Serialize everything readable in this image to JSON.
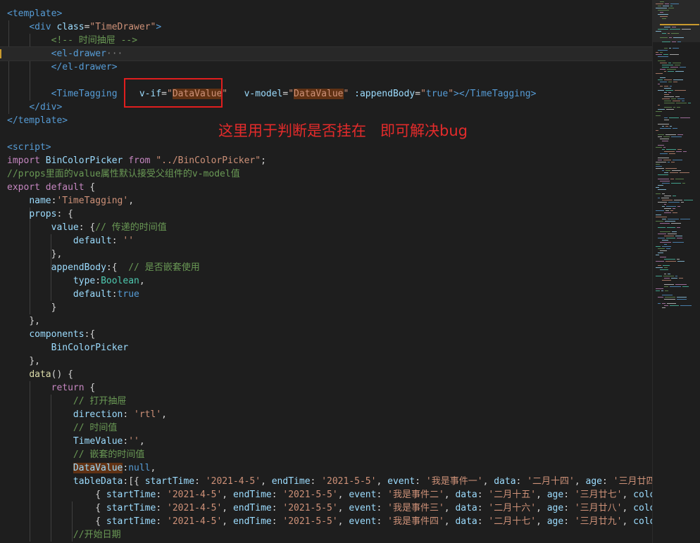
{
  "editor": {
    "lines": [
      [
        [
          "tag",
          "<template>"
        ]
      ],
      [
        [
          "ws",
          "    "
        ],
        [
          "tag",
          "<div "
        ],
        [
          "attr",
          "class"
        ],
        [
          "white",
          "="
        ],
        [
          "str",
          "\"TimeDrawer\""
        ],
        [
          "tag",
          ">"
        ]
      ],
      [
        [
          "ws",
          "        "
        ],
        [
          "cmt",
          "<!-- 时间抽屉 -->"
        ]
      ],
      [
        [
          "ws",
          "        "
        ],
        [
          "tag",
          "<el-drawer"
        ],
        [
          "punc",
          "···"
        ]
      ],
      [
        [
          "ws",
          "        "
        ],
        [
          "tag",
          "</el-drawer>"
        ]
      ],
      [],
      [
        [
          "ws",
          "        "
        ],
        [
          "tag",
          "<TimeTagging  "
        ],
        [
          "ws",
          "  "
        ],
        [
          "attr",
          "v-if"
        ],
        [
          "white",
          "="
        ],
        [
          "str",
          "\""
        ],
        [
          "strhl",
          "DataValue"
        ],
        [
          "str",
          "\""
        ],
        [
          "ws",
          "   "
        ],
        [
          "attr",
          "v-model"
        ],
        [
          "white",
          "="
        ],
        [
          "str",
          "\""
        ],
        [
          "strhl",
          "DataValue"
        ],
        [
          "str",
          "\""
        ],
        [
          "ws",
          " "
        ],
        [
          "attr",
          ":appendBody"
        ],
        [
          "white",
          "="
        ],
        [
          "str",
          "\""
        ],
        [
          "blue",
          "true"
        ],
        [
          "str",
          "\""
        ],
        [
          "tag",
          "></TimeTagging>"
        ]
      ],
      [
        [
          "ws",
          "    "
        ],
        [
          "tag",
          "</div>"
        ]
      ],
      [
        [
          "tag",
          "</template>"
        ]
      ],
      [],
      [
        [
          "tag",
          "<script>"
        ]
      ],
      [
        [
          "kw",
          "import "
        ],
        [
          "ident",
          "BinColorPicker "
        ],
        [
          "kw",
          "from "
        ],
        [
          "str",
          "\"../BinColorPicker\""
        ],
        [
          "white",
          ";"
        ]
      ],
      [
        [
          "cmt",
          "//props里面的value属性默认接受父组件的v-model值"
        ]
      ],
      [
        [
          "kw",
          "export default "
        ],
        [
          "white",
          "{"
        ]
      ],
      [
        [
          "ws",
          "    "
        ],
        [
          "ident",
          "name"
        ],
        [
          "white",
          ":"
        ],
        [
          "str",
          "'TimeTagging'"
        ],
        [
          "white",
          ","
        ]
      ],
      [
        [
          "ws",
          "    "
        ],
        [
          "ident",
          "props"
        ],
        [
          "white",
          ": {"
        ]
      ],
      [
        [
          "ws",
          "        "
        ],
        [
          "ident",
          "value"
        ],
        [
          "white",
          ": {"
        ],
        [
          "cmt",
          "// 传递的时间值"
        ]
      ],
      [
        [
          "ws",
          "            "
        ],
        [
          "ident",
          "default"
        ],
        [
          "white",
          ": "
        ],
        [
          "str",
          "''"
        ]
      ],
      [
        [
          "ws",
          "        "
        ],
        [
          "white",
          "},"
        ]
      ],
      [
        [
          "ws",
          "        "
        ],
        [
          "ident",
          "appendBody"
        ],
        [
          "white",
          ":{  "
        ],
        [
          "cmt",
          "// 是否嵌套使用"
        ]
      ],
      [
        [
          "ws",
          "            "
        ],
        [
          "ident",
          "type"
        ],
        [
          "white",
          ":"
        ],
        [
          "type",
          "Boolean"
        ],
        [
          "white",
          ","
        ]
      ],
      [
        [
          "ws",
          "            "
        ],
        [
          "ident",
          "default"
        ],
        [
          "white",
          ":"
        ],
        [
          "blue",
          "true"
        ]
      ],
      [
        [
          "ws",
          "        "
        ],
        [
          "white",
          "}"
        ]
      ],
      [
        [
          "ws",
          "    "
        ],
        [
          "white",
          "},"
        ]
      ],
      [
        [
          "ws",
          "    "
        ],
        [
          "ident",
          "components"
        ],
        [
          "white",
          ":{"
        ]
      ],
      [
        [
          "ws",
          "        "
        ],
        [
          "ident",
          "BinColorPicker"
        ]
      ],
      [
        [
          "ws",
          "    "
        ],
        [
          "white",
          "},"
        ]
      ],
      [
        [
          "ws",
          "    "
        ],
        [
          "fn",
          "data"
        ],
        [
          "white",
          "() {"
        ]
      ],
      [
        [
          "ws",
          "        "
        ],
        [
          "kw",
          "return "
        ],
        [
          "white",
          "{"
        ]
      ],
      [
        [
          "ws",
          "            "
        ],
        [
          "cmt",
          "// 打开抽屉"
        ]
      ],
      [
        [
          "ws",
          "            "
        ],
        [
          "ident",
          "direction"
        ],
        [
          "white",
          ": "
        ],
        [
          "str",
          "'rtl'"
        ],
        [
          "white",
          ","
        ]
      ],
      [
        [
          "ws",
          "            "
        ],
        [
          "cmt",
          "// 时间值"
        ]
      ],
      [
        [
          "ws",
          "            "
        ],
        [
          "ident",
          "TimeValue"
        ],
        [
          "white",
          ":"
        ],
        [
          "str",
          "''"
        ],
        [
          "white",
          ","
        ]
      ],
      [
        [
          "ws",
          "            "
        ],
        [
          "cmt",
          "// 嵌套的时间值"
        ]
      ],
      [
        [
          "ws",
          "            "
        ],
        [
          "identhl",
          "DataValue"
        ],
        [
          "white",
          ":"
        ],
        [
          "blue",
          "null"
        ],
        [
          "white",
          ","
        ]
      ],
      [
        [
          "ws",
          "            "
        ],
        [
          "ident",
          "tableData"
        ],
        [
          "white",
          ":[{ "
        ],
        [
          "ident",
          "startTime"
        ],
        [
          "white",
          ": "
        ],
        [
          "str",
          "'2021-4-5'"
        ],
        [
          "white",
          ", "
        ],
        [
          "ident",
          "endTime"
        ],
        [
          "white",
          ": "
        ],
        [
          "str",
          "'2021-5-5'"
        ],
        [
          "white",
          ", "
        ],
        [
          "ident",
          "event"
        ],
        [
          "white",
          ": "
        ],
        [
          "str",
          "'我是事件一'"
        ],
        [
          "white",
          ", "
        ],
        [
          "ident",
          "data"
        ],
        [
          "white",
          ": "
        ],
        [
          "str",
          "'二月十四'"
        ],
        [
          "white",
          ", "
        ],
        [
          "ident",
          "age"
        ],
        [
          "white",
          ": "
        ],
        [
          "str",
          "'三月廿四'"
        ]
      ],
      [
        [
          "ws",
          "                "
        ],
        [
          "white",
          "{ "
        ],
        [
          "ident",
          "startTime"
        ],
        [
          "white",
          ": "
        ],
        [
          "str",
          "'2021-4-5'"
        ],
        [
          "white",
          ", "
        ],
        [
          "ident",
          "endTime"
        ],
        [
          "white",
          ": "
        ],
        [
          "str",
          "'2021-5-5'"
        ],
        [
          "white",
          ", "
        ],
        [
          "ident",
          "event"
        ],
        [
          "white",
          ": "
        ],
        [
          "str",
          "'我是事件二'"
        ],
        [
          "white",
          ", "
        ],
        [
          "ident",
          "data"
        ],
        [
          "white",
          ": "
        ],
        [
          "str",
          "'二月十五'"
        ],
        [
          "white",
          ", "
        ],
        [
          "ident",
          "age"
        ],
        [
          "white",
          ": "
        ],
        [
          "str",
          "'三月廿七'"
        ],
        [
          "white",
          ", "
        ],
        [
          "ident",
          "colo"
        ]
      ],
      [
        [
          "ws",
          "                "
        ],
        [
          "white",
          "{ "
        ],
        [
          "ident",
          "startTime"
        ],
        [
          "white",
          ": "
        ],
        [
          "str",
          "'2021-4-5'"
        ],
        [
          "white",
          ", "
        ],
        [
          "ident",
          "endTime"
        ],
        [
          "white",
          ": "
        ],
        [
          "str",
          "'2021-5-5'"
        ],
        [
          "white",
          ", "
        ],
        [
          "ident",
          "event"
        ],
        [
          "white",
          ": "
        ],
        [
          "str",
          "'我是事件三'"
        ],
        [
          "white",
          ", "
        ],
        [
          "ident",
          "data"
        ],
        [
          "white",
          ": "
        ],
        [
          "str",
          "'二月十六'"
        ],
        [
          "white",
          ", "
        ],
        [
          "ident",
          "age"
        ],
        [
          "white",
          ": "
        ],
        [
          "str",
          "'三月廿八'"
        ],
        [
          "white",
          ", "
        ],
        [
          "ident",
          "colo"
        ]
      ],
      [
        [
          "ws",
          "                "
        ],
        [
          "white",
          "{ "
        ],
        [
          "ident",
          "startTime"
        ],
        [
          "white",
          ": "
        ],
        [
          "str",
          "'2021-4-5'"
        ],
        [
          "white",
          ", "
        ],
        [
          "ident",
          "endTime"
        ],
        [
          "white",
          ": "
        ],
        [
          "str",
          "'2021-5-5'"
        ],
        [
          "white",
          ", "
        ],
        [
          "ident",
          "event"
        ],
        [
          "white",
          ": "
        ],
        [
          "str",
          "'我是事件四'"
        ],
        [
          "white",
          ", "
        ],
        [
          "ident",
          "data"
        ],
        [
          "white",
          ": "
        ],
        [
          "str",
          "'二月十七'"
        ],
        [
          "white",
          ", "
        ],
        [
          "ident",
          "age"
        ],
        [
          "white",
          ": "
        ],
        [
          "str",
          "'三月廿九'"
        ],
        [
          "white",
          ", "
        ],
        [
          "ident",
          "colo"
        ]
      ],
      [
        [
          "ws",
          "            "
        ],
        [
          "cmt",
          "//开始日期"
        ]
      ]
    ]
  },
  "annotation": {
    "text": "这里用于判断是否挂在   即可解决bug"
  },
  "colors": {
    "background": "#1e1e1e",
    "annotation_red": "#e01e1e",
    "word_highlight": "#613214"
  }
}
